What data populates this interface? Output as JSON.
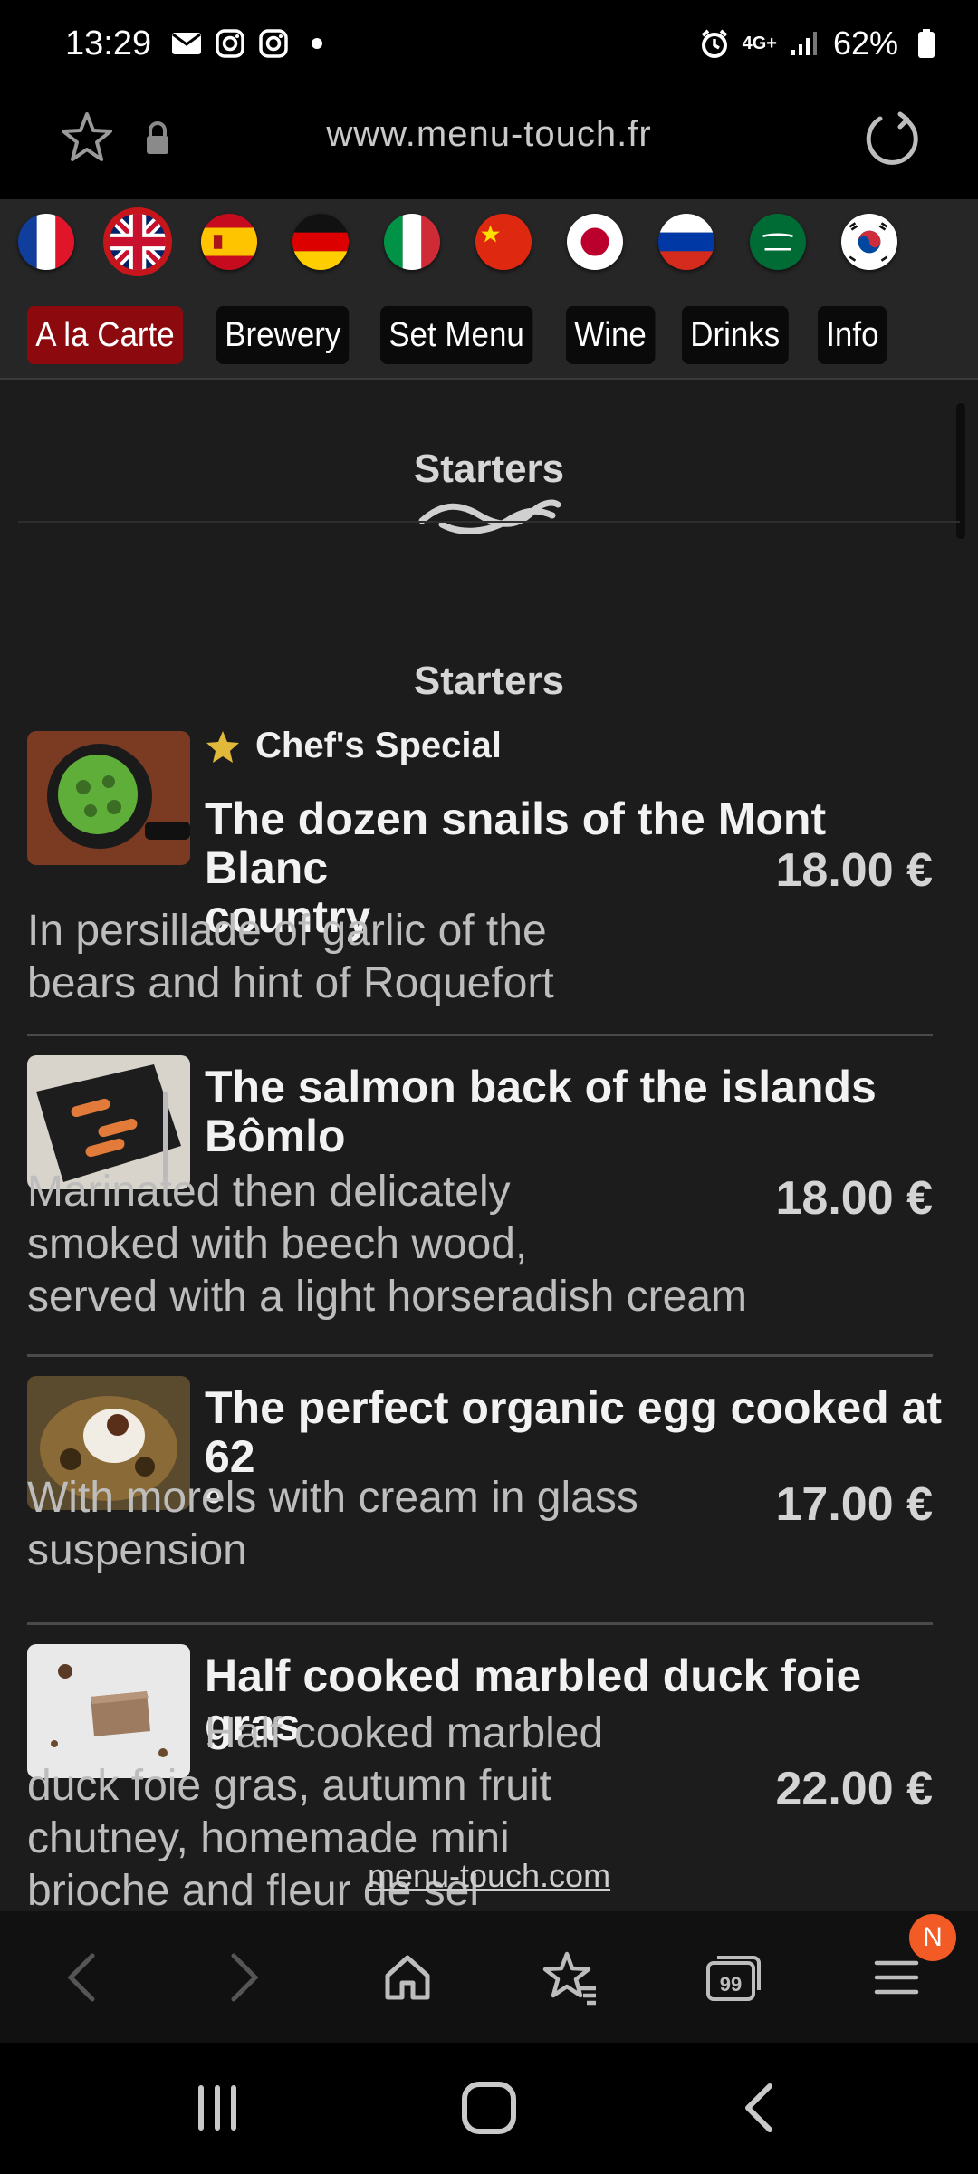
{
  "status_bar": {
    "time": "13:29",
    "battery": "62%",
    "network": "4G+"
  },
  "url_bar": {
    "url": "www.menu-touch.fr"
  },
  "flags": [
    {
      "name": "france-flag"
    },
    {
      "name": "uk-flag",
      "selected": true
    },
    {
      "name": "spain-flag"
    },
    {
      "name": "germany-flag"
    },
    {
      "name": "italy-flag"
    },
    {
      "name": "china-flag"
    },
    {
      "name": "japan-flag"
    },
    {
      "name": "russia-flag"
    },
    {
      "name": "saudi-arabia-flag"
    },
    {
      "name": "south-korea-flag"
    }
  ],
  "tabs": [
    {
      "label": "A la Carte",
      "active": true
    },
    {
      "label": "Brewery"
    },
    {
      "label": "Set Menu"
    },
    {
      "label": "Wine"
    },
    {
      "label": "Drinks"
    },
    {
      "label": "Info"
    }
  ],
  "menu": {
    "header_title": "Starters",
    "section_title": "Starters",
    "items": [
      {
        "badge": "Chef's Special",
        "name_line1": "The dozen snails of the Mont Blanc",
        "name_line2": "country",
        "price": "18.00 €",
        "desc_line1": "In persillade of garlic of the",
        "desc_line2": "bears and hint of Roquefort"
      },
      {
        "name_line1": "The salmon back of the islands",
        "name_line2": "Bômlo",
        "price": "18.00 €",
        "desc_line1": "Marinated then delicately",
        "desc_line2": "smoked with beech wood,",
        "desc_line3": "served with a light horseradish cream"
      },
      {
        "name_line1": "The perfect organic egg cooked at 62",
        "name_line2": "°",
        "price": "17.00 €",
        "desc_line1": "With morels with cream in glass",
        "desc_line2": "suspension"
      },
      {
        "name_line1": "Half cooked marbled duck foie gras",
        "price": "22.00 €",
        "desc_line1": "Half cooked marbled",
        "desc_line2": "duck foie gras, autumn fruit",
        "desc_line3": "chutney, homemade mini",
        "desc_line4": "brioche and fleur de sel"
      }
    ]
  },
  "watermark": "menu-touch.com",
  "toolbar": {
    "tabs_count": "99",
    "menu_badge": "N"
  },
  "colors": {
    "accent_red": "#8c0a0e",
    "badge_orange": "#f25a26",
    "page_bg": "#1c1c1c"
  }
}
